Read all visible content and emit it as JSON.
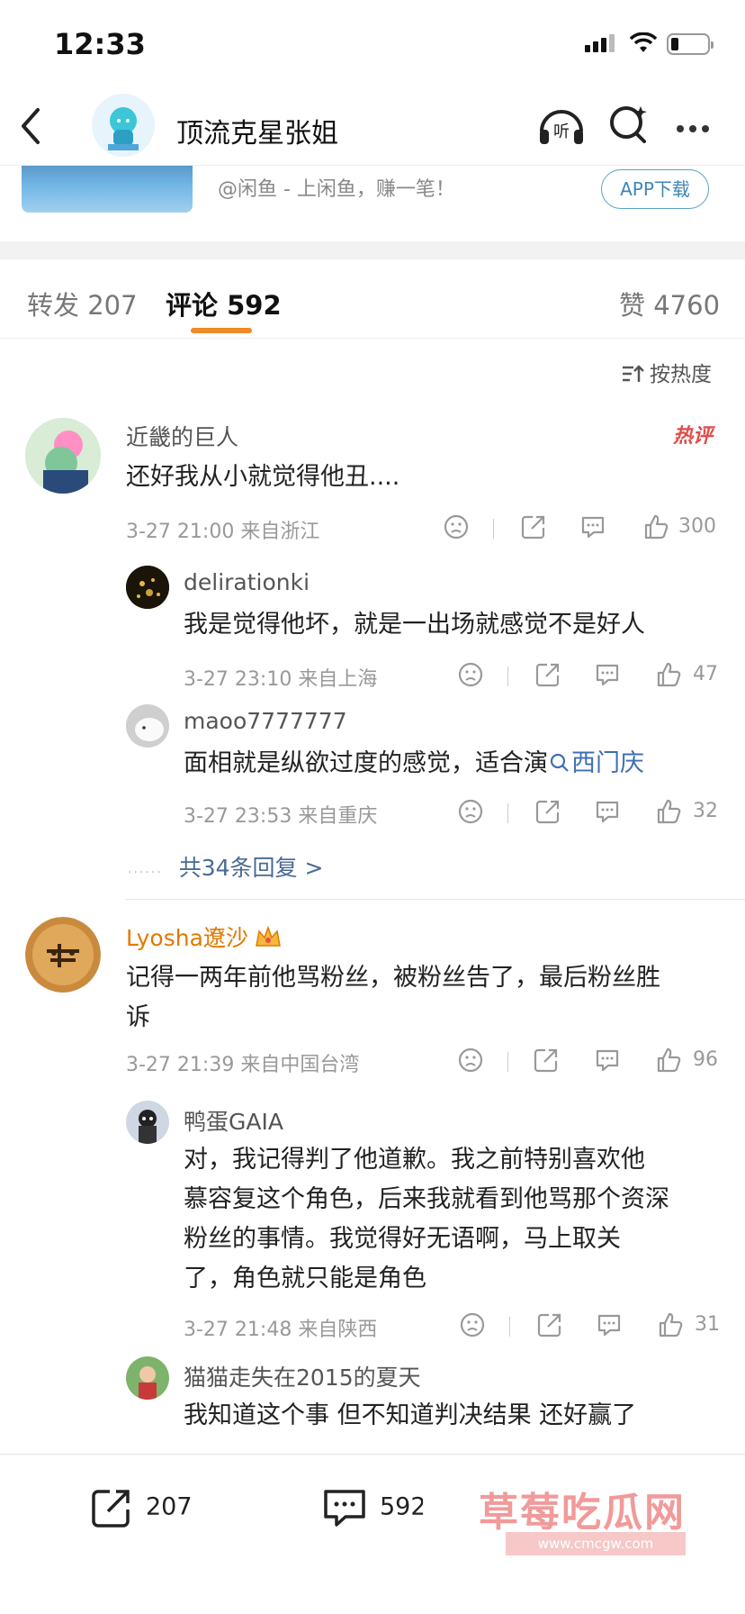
{
  "status_bar": {
    "time": "12:33"
  },
  "nav": {
    "title": "顶流克星张姐"
  },
  "ad": {
    "text": "@闲鱼 - 上闲鱼，赚一笔！",
    "button": "APP下载"
  },
  "tabs": {
    "repost_label": "转发",
    "repost_count": "207",
    "comment_label": "评论",
    "comment_count": "592",
    "like_label": "赞",
    "like_count": "4760"
  },
  "sort": {
    "label": "按热度"
  },
  "comments": [
    {
      "user": "近畿的巨人",
      "badge": "热评",
      "text": "还好我从小就觉得他丑....",
      "meta": "3-27 21:00  来自浙江",
      "likes": "300",
      "replies": [
        {
          "user": "delirationki",
          "text": "我是觉得他坏，就是一出场就感觉不是好人",
          "meta": "3-27 23:10  来自上海",
          "likes": "47"
        },
        {
          "user": "maoo7777777",
          "text": "面相就是纵欲过度的感觉，适合演",
          "link": "西门庆",
          "meta": "3-27 23:53  来自重庆",
          "likes": "32"
        }
      ],
      "more": "共34条回复 >"
    },
    {
      "user": "Lyosha遼沙",
      "text_line1": "记得一两年前他骂粉丝，被粉丝告了，最后粉丝胜",
      "text_line2": "诉",
      "meta": "3-27 21:39  来自中国台湾",
      "likes": "96",
      "replies": [
        {
          "user": "鸭蛋GAIA",
          "lines": [
            "对，我记得判了他道歉。我之前特别喜欢他",
            "慕容复这个角色，后来我就看到他骂那个资深",
            "粉丝的事情。我觉得好无语啊，马上取关",
            "了，角色就只能是角色"
          ],
          "meta": "3-27 21:48  来自陕西",
          "likes": "31"
        },
        {
          "user": "猫猫走失在2015的夏天",
          "text": "我知道这个事   但不知道判决结果    还好赢了"
        }
      ]
    }
  ],
  "bottom_bar": {
    "repost": "207",
    "comment": "592"
  },
  "watermark": {
    "text": "草莓吃瓜网",
    "sub": "www.cmcgw.com"
  },
  "colors": {
    "accent": "#f08a24",
    "link": "#3f6fb0",
    "vip": "#e07a00",
    "hot": "#e34b4b"
  }
}
